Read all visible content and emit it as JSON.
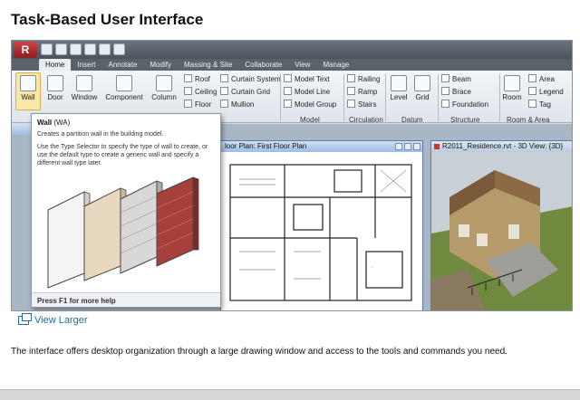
{
  "page": {
    "title": "Task-Based User Interface",
    "view_larger_label": "View Larger",
    "description": "The interface offers desktop organization through a large drawing window and access to the tools and commands you need."
  },
  "app": {
    "tabs": [
      "Home",
      "Insert",
      "Annotate",
      "Modify",
      "Massing & Site",
      "Collaborate",
      "View",
      "Manage"
    ],
    "ribbon": {
      "wall": "Wall",
      "door": "Door",
      "window": "Window",
      "component": "Component",
      "column": "Column",
      "roof": "Roof",
      "ceiling": "Ceiling",
      "floor": "Floor",
      "curtain_system": "Curtain System",
      "curtain_grid": "Curtain Grid",
      "mullion": "Mullion",
      "model_text": "Model Text",
      "model_line": "Model Line",
      "model_group": "Model Group",
      "railing": "Railing",
      "ramp": "Ramp",
      "stairs": "Stairs",
      "level": "Level",
      "grid": "Grid",
      "beam": "Beam",
      "brace": "Brace",
      "foundation": "Foundation",
      "room": "Room",
      "area": "Area",
      "legend": "Legend",
      "tag": "Tag",
      "panels": {
        "model": "Model",
        "circulation": "Circulation",
        "datum": "Datum",
        "structure": "Structure",
        "room_area": "Room & Area"
      }
    },
    "plan_window_title": "loor Plan: First Floor Plan",
    "view_window_title": "R2011_Residence.rvt - 3D View: {3D}",
    "tooltip": {
      "title": "Wall",
      "shortcut": "(WA)",
      "line1": "Creates a partition wall in the building model.",
      "line2": "Use the Type Selector to specify the type of wall to create, or",
      "line3": "use the default type to create a generic wall and specify a",
      "line4": "different wall type later.",
      "footer": "Press F1 for more help"
    }
  }
}
